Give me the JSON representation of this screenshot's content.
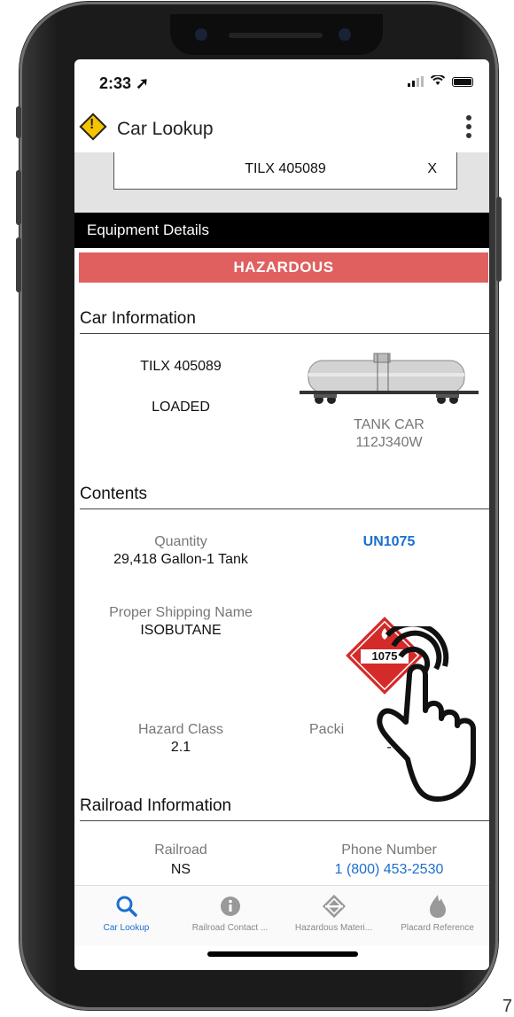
{
  "status": {
    "time": "2:33"
  },
  "app": {
    "title": "Car Lookup"
  },
  "search": {
    "value": "TILX 405089",
    "clear": "X"
  },
  "section_title": "Equipment Details",
  "hazard_banner": "HAZARDOUS",
  "car_info": {
    "heading": "Car Information",
    "car_id": "TILX 405089",
    "load_status": "LOADED",
    "car_type": "TANK CAR",
    "car_spec": "112J340W"
  },
  "contents": {
    "heading": "Contents",
    "quantity_label": "Quantity",
    "quantity_value": "29,418 Gallon-1 Tank",
    "un_number": "UN1075",
    "psn_label": "Proper Shipping Name",
    "psn_value": "ISOBUTANE",
    "placard_number": "1075",
    "hazard_class_label": "Hazard Class",
    "hazard_class_value": "2.1",
    "packing_label": "Packi",
    "packing_value": "-"
  },
  "railroad": {
    "heading": "Railroad Information",
    "railroad_label": "Railroad",
    "railroad_value": "NS",
    "phone_label": "Phone Number",
    "phone_value": "1 (800) 453-2530"
  },
  "tabs": [
    {
      "label": "Car Lookup",
      "icon": "search-icon",
      "active": true
    },
    {
      "label": "Railroad Contact ...",
      "icon": "info-icon",
      "active": false
    },
    {
      "label": "Hazardous Materi...",
      "icon": "hazmat-icon",
      "active": false
    },
    {
      "label": "Placard Reference",
      "icon": "flame-icon",
      "active": false
    }
  ],
  "page_number": "7",
  "colors": {
    "hazard": "#e06060",
    "link": "#1a6fd0",
    "accent_yellow": "#f5c400"
  }
}
